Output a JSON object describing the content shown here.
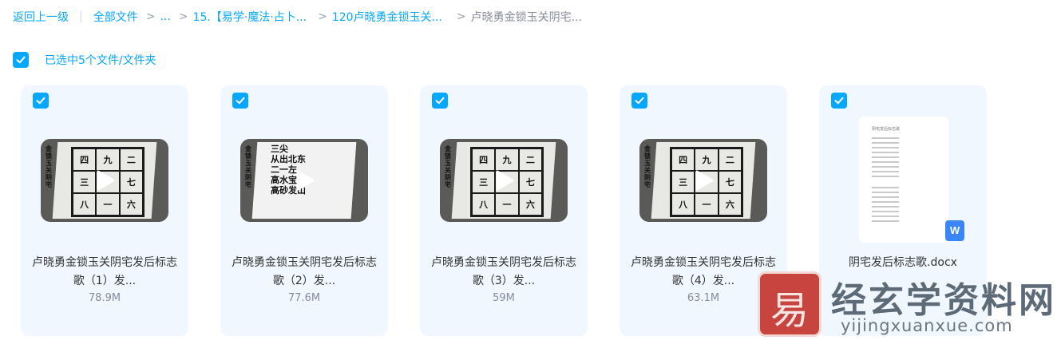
{
  "breadcrumb": {
    "back": "返回上一级",
    "all_files": "全部文件",
    "ellipsis": "...",
    "level1": "15.【易学·魔法·占卜...",
    "level2": "120卢晓勇金锁玉关...",
    "current": "卢晓勇金锁玉关阴宅..."
  },
  "selection": {
    "text": "已选中5个文件/文件夹",
    "checked": true
  },
  "files": [
    {
      "name": "卢晓勇金锁玉关阴宅发后标志歌（1）发...",
      "size": "78.9M",
      "type": "video"
    },
    {
      "name": "卢晓勇金锁玉关阴宅发后标志歌（2）发...",
      "size": "77.6M",
      "type": "video"
    },
    {
      "name": "卢晓勇金锁玉关阴宅发后标志歌（3）发...",
      "size": "59M",
      "type": "video"
    },
    {
      "name": "卢晓勇金锁玉关阴宅发后标志歌（4）发...",
      "size": "63.1M",
      "type": "video"
    },
    {
      "name": "阴宅发后标志歌.docx",
      "size": "",
      "type": "docx"
    }
  ],
  "thumb_text": {
    "grid": [
      "四",
      "九",
      "二",
      "三",
      "",
      "七",
      "八",
      "一",
      "六"
    ],
    "side": "金锁玉关阴宅",
    "lines": [
      "三尖",
      "从出北东",
      "二一左",
      "高水宝黄",
      "高砂发山"
    ]
  },
  "doc_title": "阴宅发后标志歌",
  "word_badge": "W",
  "watermark": {
    "cn": "经玄学资料网",
    "en": "yijingxuanxue.com",
    "seal": "易"
  },
  "colors": {
    "accent": "#06a7ff",
    "card_bg": "#f0f7ff",
    "muted": "#878c9c"
  }
}
